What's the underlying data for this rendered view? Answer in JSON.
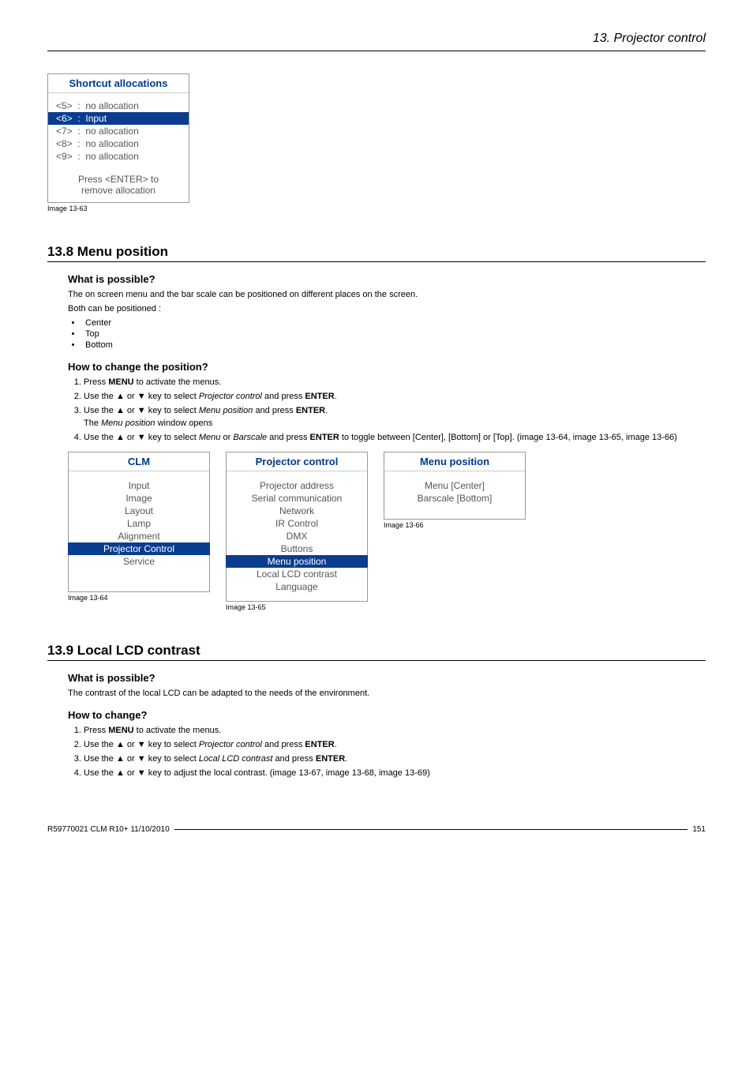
{
  "header": {
    "chapter": "13.  Projector control"
  },
  "fig1363": {
    "title": "Shortcut allocations",
    "r5": "<5>  :  no allocation",
    "r6": "<6>  :  Input",
    "r7": "<7>  :  no allocation",
    "r8": "<8>  :  no allocation",
    "r9": "<9>  :  no allocation",
    "foot1": "Press <ENTER> to",
    "foot2": "remove allocation",
    "caption": "Image 13-63"
  },
  "sec138": {
    "title": "13.8  Menu position",
    "sub1": "What is possible?",
    "p1": "The on screen menu and the bar scale can be positioned on different places on the screen.",
    "p2": "Both can be positioned :",
    "b1": "Center",
    "b2": "Top",
    "b3": "Bottom",
    "sub2": "How to change the position?",
    "s1a": "Press ",
    "s1b": "MENU",
    "s1c": " to activate the menus.",
    "s2a": "Use the ▲ or ▼ key to select ",
    "s2b": "Projector control",
    "s2c": " and press ",
    "s2d": "ENTER",
    "s2e": ".",
    "s3a": "Use the ▲ or ▼ key to select ",
    "s3b": "Menu position",
    "s3c": " and press ",
    "s3d": "ENTER",
    "s3e": ".",
    "s3f": "The ",
    "s3g": "Menu position",
    "s3h": " window opens",
    "s4a": "Use the ▲ or ▼ key to select ",
    "s4b": "Menu",
    "s4c": " or ",
    "s4d": "Barscale",
    "s4e": " and press ",
    "s4f": "ENTER",
    "s4g": " to toggle between [Center], [Bottom] or [Top]. (image 13-64, image 13-65, image 13-66)"
  },
  "fig1364": {
    "title": "CLM",
    "i1": "Input",
    "i2": "Image",
    "i3": "Layout",
    "i4": "Lamp",
    "i5": "Alignment",
    "sel": "Projector Control",
    "i7": "Service",
    "caption": "Image 13-64"
  },
  "fig1365": {
    "title": "Projector control",
    "i1": "Projector address",
    "i2": "Serial communication",
    "i3": "Network",
    "i4": "IR Control",
    "i5": "DMX",
    "i6": "Buttons",
    "sel": "Menu position",
    "i8": "Local LCD contrast",
    "i9": "Language",
    "caption": "Image 13-65"
  },
  "fig1366": {
    "title": "Menu position",
    "i1": "Menu [Center]",
    "i2": "Barscale [Bottom]",
    "caption": "Image 13-66"
  },
  "sec139": {
    "title": "13.9  Local LCD contrast",
    "sub1": "What is possible?",
    "p1": "The contrast of the local LCD can be adapted to the needs of the environment.",
    "sub2": "How to change?",
    "s1a": "Press ",
    "s1b": "MENU",
    "s1c": " to activate the menus.",
    "s2a": "Use the ▲ or ▼ key to select ",
    "s2b": "Projector control",
    "s2c": " and press ",
    "s2d": "ENTER",
    "s2e": ".",
    "s3a": "Use the ▲ or ▼ key to select ",
    "s3b": "Local LCD contrast",
    "s3c": " and press ",
    "s3d": "ENTER",
    "s3e": ".",
    "s4": "Use the ▲ or ▼ key to adjust the local contrast. (image 13-67, image 13-68, image 13-69)"
  },
  "footer": {
    "left": "R59770021  CLM R10+  11/10/2010",
    "right": "151"
  }
}
